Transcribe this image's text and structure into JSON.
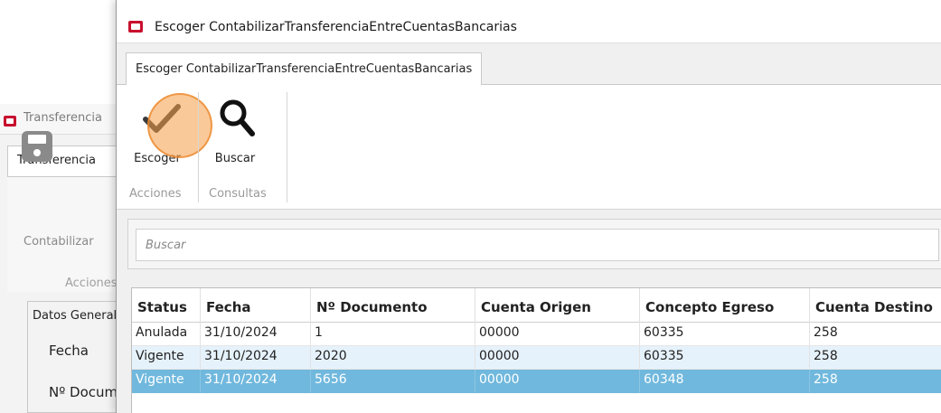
{
  "background_window": {
    "title": "Transferencia",
    "tab_label": "Transferencia",
    "save_label": "Contabilizar",
    "group_label": "Acciones",
    "section_title": "Datos Generales",
    "fields": {
      "fecha_label": "Fecha",
      "ndoc_label": "Nº Documento"
    }
  },
  "dialog": {
    "title": "Escoger ContabilizarTransferenciaEntreCuentasBancarias",
    "tab_label": "Escoger ContabilizarTransferenciaEntreCuentasBancarias",
    "ribbon": {
      "escoger_label": "Escoger",
      "buscar_label": "Buscar",
      "group_acciones": "Acciones",
      "group_consultas": "Consultas"
    },
    "search": {
      "placeholder": "Buscar"
    },
    "grid": {
      "columns": [
        "Status",
        "Fecha",
        "Nº Documento",
        "Cuenta Origen",
        "Concepto Egreso",
        "Cuenta Destino"
      ],
      "rows": [
        [
          "Anulada",
          "31/10/2024",
          "1",
          "00000",
          "60335",
          "258"
        ],
        [
          "Vigente",
          "31/10/2024",
          "2020",
          "00000",
          "60335",
          "258"
        ],
        [
          "Vigente",
          "31/10/2024",
          "5656",
          "00000",
          "60348",
          "258"
        ]
      ],
      "selected_row": 2
    }
  },
  "colors": {
    "app_icon_red": "#c8102e",
    "highlight_orange": "#f69c46",
    "selected_row": "#70b8dd",
    "alt_row": "#e6f2fb"
  },
  "icons": [
    "app-icon",
    "checkmark-icon",
    "search-icon",
    "save-icon"
  ]
}
